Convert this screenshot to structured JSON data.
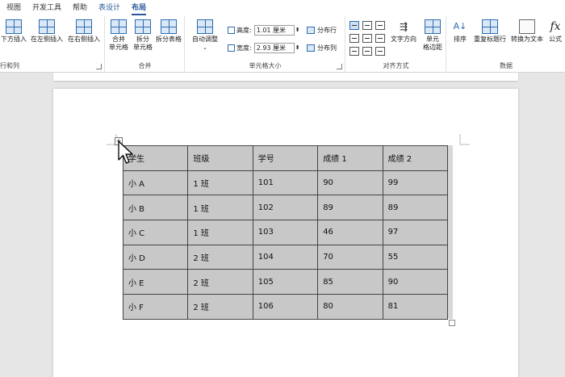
{
  "tabs": [
    {
      "label": "视图"
    },
    {
      "label": "开发工具"
    },
    {
      "label": "帮助"
    },
    {
      "label": "表设计"
    },
    {
      "label": "布局"
    }
  ],
  "ribbon": {
    "rows_cols": {
      "insert_below": "下方插入",
      "insert_left": "在左侧插入",
      "insert_right": "在右侧插入",
      "group_label": "行和列"
    },
    "merge": {
      "merge_cells": [
        "合并",
        "单元格"
      ],
      "split_cells": [
        "拆分",
        "单元格"
      ],
      "split_table": "拆分表格",
      "group_label": "合并"
    },
    "cell_size": {
      "autofit": "自动调整",
      "height_label": "高度:",
      "height_value": "1.01 厘米",
      "width_label": "宽度:",
      "width_value": "2.93 厘米",
      "distribute_rows": "分布行",
      "distribute_cols": "分布列",
      "group_label": "单元格大小"
    },
    "alignment": {
      "text_direction": "文字方向",
      "cell_margins": [
        "单元",
        "格边距"
      ],
      "group_label": "对齐方式"
    },
    "data": {
      "sort": "排序",
      "repeat_header": "重复标题行",
      "convert_text": "转换为文本",
      "formula": "公式",
      "formula_symbol": "fx",
      "group_label": "数据"
    }
  },
  "table": {
    "headers": [
      "学生",
      "班级",
      "学号",
      "成绩 1",
      "成绩 2"
    ],
    "rows": [
      [
        "小 A",
        "1 班",
        "101",
        "90",
        "99"
      ],
      [
        "小 B",
        "1 班",
        "102",
        "89",
        "89"
      ],
      [
        "小 C",
        "1 班",
        "103",
        "46",
        "97"
      ],
      [
        "小 D",
        "2 班",
        "104",
        "70",
        "55"
      ],
      [
        "小 E",
        "2 班",
        "105",
        "85",
        "90"
      ],
      [
        "小 F",
        "2 班",
        "106",
        "80",
        "81"
      ]
    ]
  },
  "colors": {
    "accent": "#2b579a",
    "selection": "#c8c8c8"
  }
}
